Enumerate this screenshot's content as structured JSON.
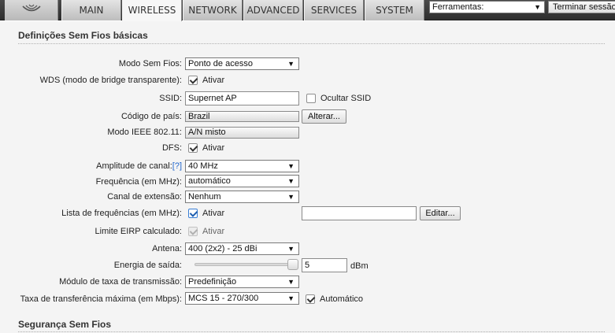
{
  "nav": {
    "logo_icon": "ubiquiti-logo-icon",
    "tabs": [
      "MAIN",
      "WIRELESS",
      "NETWORK",
      "ADVANCED",
      "SERVICES",
      "SYSTEM"
    ],
    "active_tab": "WIRELESS",
    "tools_select": "Ferramentas:",
    "logout_label": "Terminar sessão"
  },
  "basic": {
    "section_title": "Definições Sem Fios básicas",
    "wireless_mode": {
      "label": "Modo Sem Fios:",
      "value": "Ponto de acesso"
    },
    "wds": {
      "label": "WDS (modo de bridge transparente):",
      "checkbox_label": "Ativar",
      "checked": true
    },
    "ssid": {
      "label": "SSID:",
      "value": "Supernet AP",
      "hide_label": "Ocultar SSID",
      "hide_checked": false
    },
    "country": {
      "label": "Código de país:",
      "value": "Brazil",
      "change_button": "Alterar..."
    },
    "ieee_mode": {
      "label": "Modo IEEE 802.11:",
      "value": "A/N misto"
    },
    "dfs": {
      "label": "DFS:",
      "checkbox_label": "Ativar",
      "checked": true
    },
    "channel_width": {
      "label": "Amplitude de canal:",
      "help": "[?]",
      "value": "40 MHz"
    },
    "frequency": {
      "label": "Frequência (em MHz):",
      "value": "automático"
    },
    "extension_channel": {
      "label": "Canal de extensão:",
      "value": "Nenhum"
    },
    "frequency_list": {
      "label": "Lista de frequências (em MHz):",
      "checkbox_label": "Ativar",
      "checked": true,
      "value": "",
      "edit_button": "Editar..."
    },
    "eirp_limit": {
      "label": "Limite EIRP calculado:",
      "checkbox_label": "Ativar",
      "checked": true,
      "disabled": true
    },
    "antenna": {
      "label": "Antena:",
      "value": "400 (2x2) - 25 dBi"
    },
    "output_power": {
      "label": "Energia de saída:",
      "value": "5",
      "unit": "dBm",
      "slider_fraction": 1.0
    },
    "rate_module": {
      "label": "Módulo de taxa de transmissão:",
      "value": "Predefinição"
    },
    "max_rate": {
      "label": "Taxa de transferência máxima (em Mbps):",
      "value": "MCS 15 - 270/300",
      "auto_label": "Automático",
      "auto_checked": true
    }
  },
  "security": {
    "section_title": "Segurança Sem Fios"
  },
  "colors": {
    "topbar": "#2e2e2e",
    "panel": "#f4f4f4",
    "link": "#2266cc"
  }
}
